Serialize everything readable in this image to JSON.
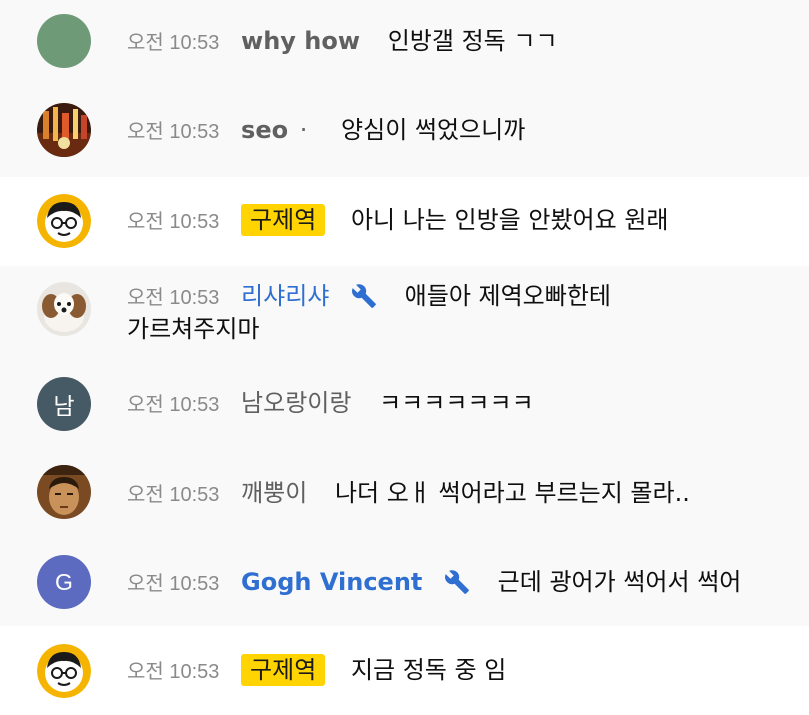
{
  "messages": [
    {
      "time": "오전 10:53",
      "author": "why how",
      "text": "인방갤 정독 ㄱㄱ",
      "avatar": {
        "type": "solid",
        "color": "#6e9a78"
      }
    },
    {
      "time": "오전 10:53",
      "author": "seo",
      "author_suffix": "·",
      "text": "양심이 썩었으니까",
      "avatar": {
        "type": "photo-city"
      }
    },
    {
      "time": "오전 10:53",
      "author": "구제역",
      "text": "아니 나는 인방을 안봤어요 원래",
      "avatar": {
        "type": "cartoon-face"
      }
    },
    {
      "time": "오전 10:53",
      "author": "리샤리샤",
      "text": "애들아 제역오빠한테",
      "text_cont": "가르쳐주지마",
      "avatar": {
        "type": "dog-photo"
      }
    },
    {
      "time": "오전 10:53",
      "author": "남오랑이랑",
      "text": "ㅋㅋㅋㅋㅋㅋㅋ",
      "avatar": {
        "type": "letter",
        "letter": "남",
        "color": "#455a64"
      }
    },
    {
      "time": "오전 10:53",
      "author": "깨뿡이",
      "text": "나더 오ㅐ 썩어라고 부르는지 몰라..",
      "avatar": {
        "type": "face-photo"
      }
    },
    {
      "time": "오전 10:53",
      "author": "Gogh Vincent",
      "text": "근데 광어가 썩어서 썩어",
      "avatar": {
        "type": "letter",
        "letter": "G",
        "color": "#5c6bc0"
      }
    },
    {
      "time": "오전 10:53",
      "author": "구제역",
      "text": "지금 정독 중 임",
      "avatar": {
        "type": "cartoon-face"
      }
    }
  ],
  "colors": {
    "moderator": "#2f6fd1",
    "owner_badge": "#ffd400",
    "time": "#8a8a8a"
  }
}
